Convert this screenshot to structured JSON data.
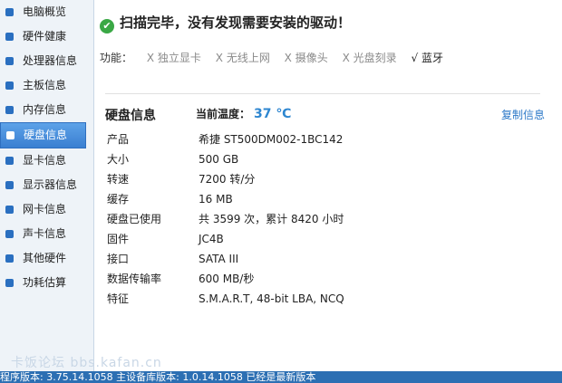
{
  "sidebar": {
    "items": [
      {
        "label": "电脑概览"
      },
      {
        "label": "硬件健康"
      },
      {
        "label": "处理器信息"
      },
      {
        "label": "主板信息"
      },
      {
        "label": "内存信息"
      },
      {
        "label": "硬盘信息",
        "active": true
      },
      {
        "label": "显卡信息"
      },
      {
        "label": "显示器信息"
      },
      {
        "label": "网卡信息"
      },
      {
        "label": "声卡信息"
      },
      {
        "label": "其他硬件"
      },
      {
        "label": "功耗估算"
      }
    ]
  },
  "status": {
    "text": "扫描完毕，没有发现需要安装的驱动！",
    "icon": "check-icon"
  },
  "features": {
    "label": "功能：",
    "items": [
      {
        "mark": "X",
        "label": "独立显卡"
      },
      {
        "mark": "X",
        "label": "无线上网"
      },
      {
        "mark": "X",
        "label": "摄像头"
      },
      {
        "mark": "X",
        "label": "光盘刻录"
      },
      {
        "mark": "√",
        "label": "蓝牙"
      }
    ]
  },
  "disk": {
    "title": "硬盘信息",
    "temp_label": "当前温度：",
    "temp_value": "37 ℃",
    "copy_label": "复制信息",
    "rows": [
      {
        "key": "产品",
        "value": "希捷 ST500DM002-1BC142"
      },
      {
        "key": "大小",
        "value": "500 GB"
      },
      {
        "key": "转速",
        "value": "7200 转/分"
      },
      {
        "key": "缓存",
        "value": "16 MB"
      },
      {
        "key": "硬盘已使用",
        "value": "共 3599 次，累计 8420 小时"
      },
      {
        "key": "固件",
        "value": "JC4B"
      },
      {
        "key": "接口",
        "value": "SATA III"
      },
      {
        "key": "数据传输率",
        "value": "600 MB/秒"
      },
      {
        "key": "特征",
        "value": "S.M.A.R.T,  48-bit LBA,  NCQ"
      }
    ]
  },
  "watermark": "卡饭论坛 bbs.kafan.cn",
  "footer": "程序版本: 3.75.14.1058   主设备库版本: 1.0.14.1058   已经是最新版本",
  "colors": {
    "accent": "#2d86d0",
    "sidebar_bg": "#eef3f8",
    "footer_bg": "#2c6fb3"
  }
}
